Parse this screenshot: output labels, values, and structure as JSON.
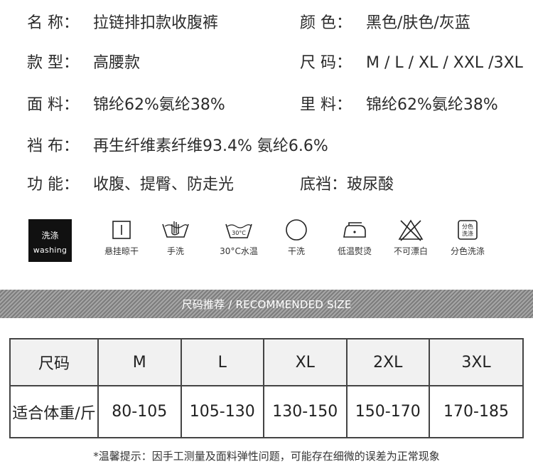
{
  "specs": {
    "name": {
      "label": "名 称：",
      "value": "拉链排扣款收腹裤"
    },
    "color": {
      "label": "颜 色：",
      "value": "黑色/肤色/灰蓝"
    },
    "style": {
      "label": "款 型：",
      "value": "高腰款"
    },
    "size": {
      "label": "尺 码：",
      "value": "M / L / XL / XXL /3XL"
    },
    "fabric": {
      "label": "面 料：",
      "value": "锦纶62%氨纶38%"
    },
    "lining": {
      "label": "里 料：",
      "value": "锦纶62%氨纶38%"
    },
    "sleeve": {
      "label": "裆 布：",
      "value": "再生纤维素纤维93.4% 氨纶6.6%"
    },
    "function": {
      "label": "功 能：",
      "value": "收腹、提臀、防走光"
    },
    "crotch": {
      "label": "底裆：",
      "value": "玻尿酸"
    }
  },
  "care": {
    "badge_cn": "洗涤",
    "badge_en": "washing",
    "items": [
      {
        "icon": "hang-dry-icon",
        "label": "悬挂晾干"
      },
      {
        "icon": "hand-wash-icon",
        "label": "手洗"
      },
      {
        "icon": "wash-30-icon",
        "label": "30°C水温",
        "mark": "30°C"
      },
      {
        "icon": "dry-clean-icon",
        "label": "干洗"
      },
      {
        "icon": "iron-low-icon",
        "label": "低温熨烫"
      },
      {
        "icon": "no-bleach-icon",
        "label": "不可漂白"
      },
      {
        "icon": "separate-wash-icon",
        "label": "分色洗涤",
        "mark_top": "分色",
        "mark_bottom": "洗涤"
      }
    ]
  },
  "banner": {
    "title": "尺码推荐 / RECOMMENDED SIZE"
  },
  "size_table": {
    "header": [
      "尺码",
      "M",
      "L",
      "XL",
      "2XL",
      "3XL"
    ],
    "row": [
      "适合体重/斤",
      "80-105",
      "105-130",
      "130-150",
      "150-170",
      "170-185"
    ]
  },
  "note": "*温馨提示：因手工测量及面料弹性问题，可能存在细微的误差为正常现象"
}
